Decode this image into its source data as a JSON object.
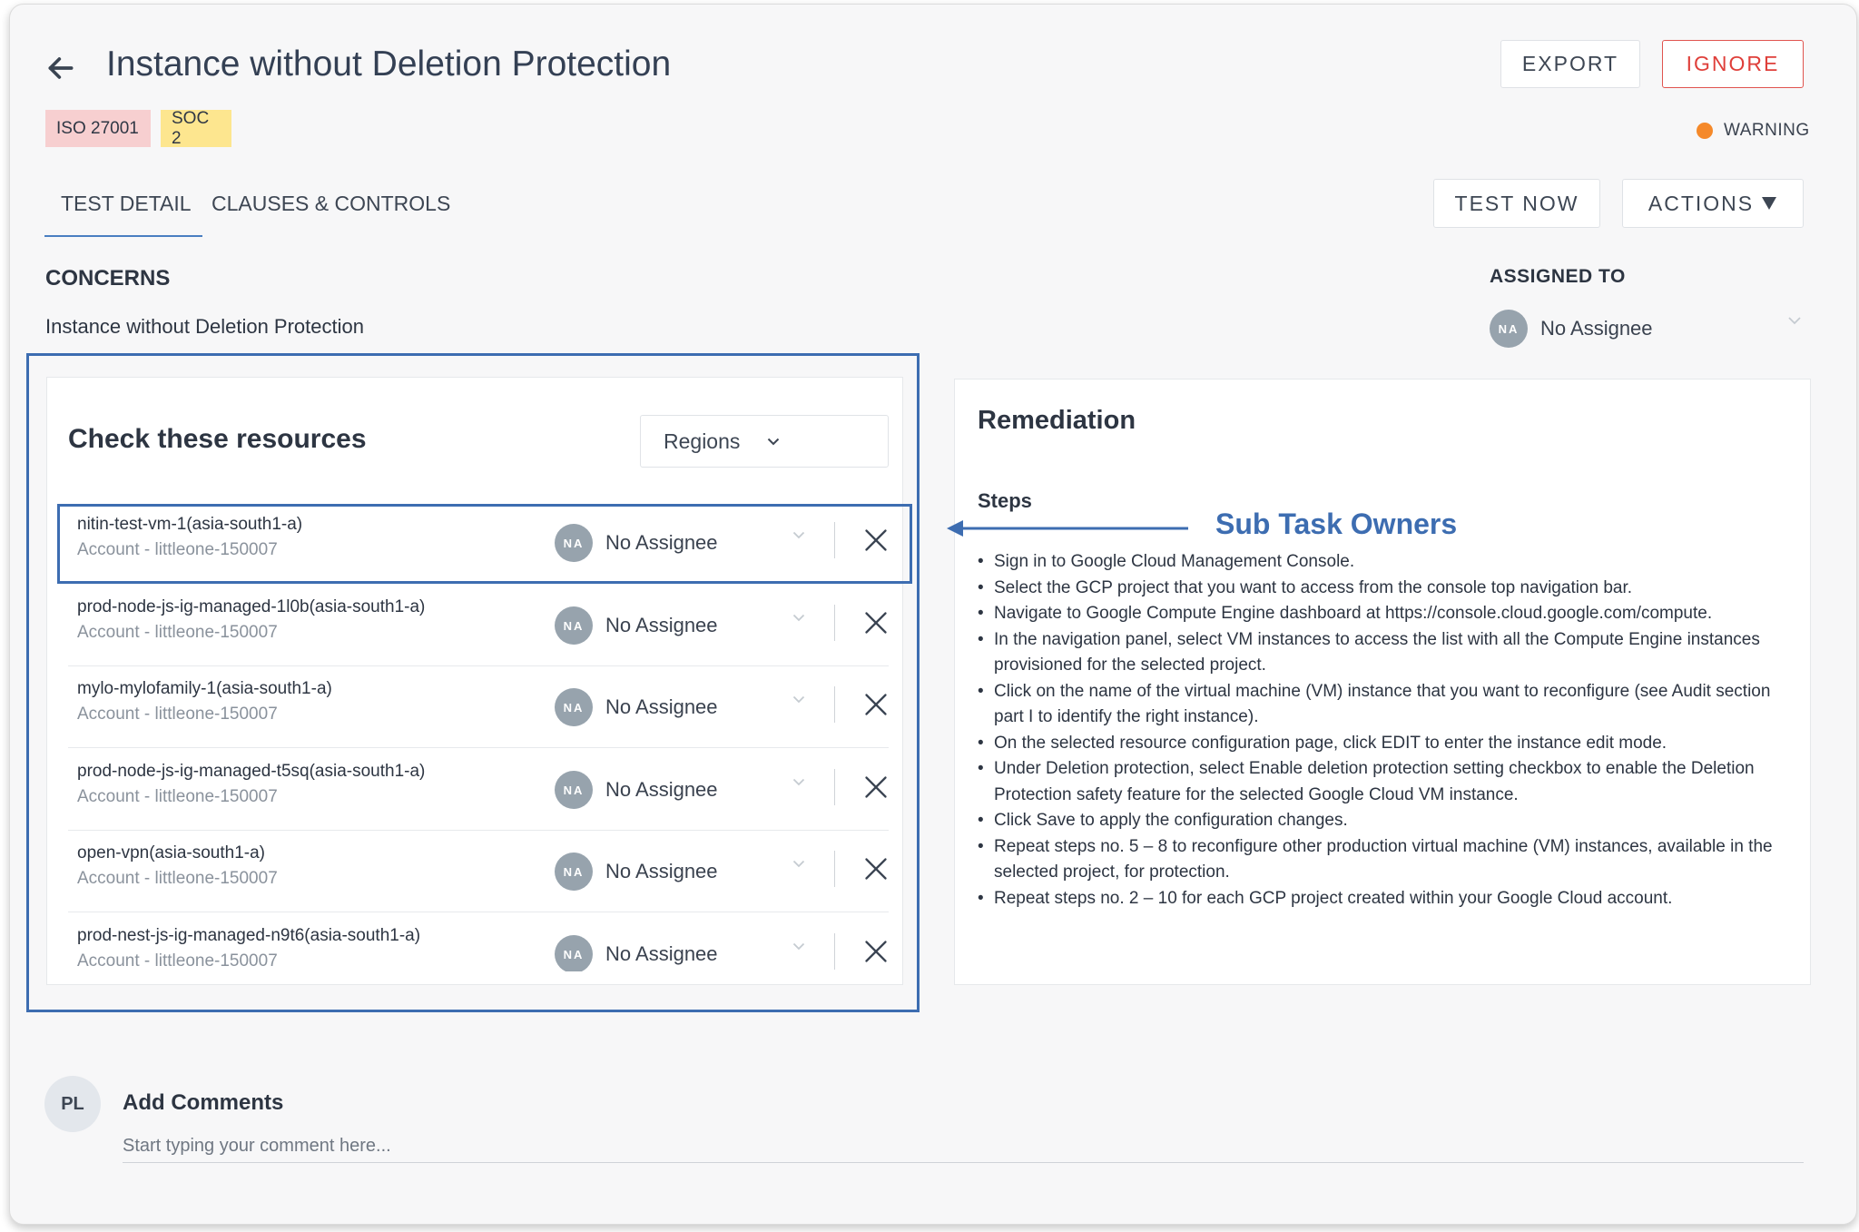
{
  "header": {
    "title": "Instance without Deletion Protection",
    "export_label": "EXPORT",
    "ignore_label": "IGNORE"
  },
  "tags": [
    "ISO 27001",
    "SOC 2"
  ],
  "status": {
    "label": "WARNING",
    "color": "#f5892a"
  },
  "tabs": [
    {
      "label": "TEST DETAIL",
      "active": true
    },
    {
      "label": "CLAUSES & CONTROLS",
      "active": false
    }
  ],
  "toolbar": {
    "test_now_label": "TEST NOW",
    "actions_label": "ACTIONS"
  },
  "concerns": {
    "heading": "CONCERNS",
    "text": "Instance without Deletion Protection"
  },
  "assigned": {
    "heading": "ASSIGNED TO",
    "initials": "NA",
    "name": "No Assignee"
  },
  "resources": {
    "title": "Check these resources",
    "regions_label": "Regions",
    "items": [
      {
        "name": "nitin-test-vm-1(asia-south1-a)",
        "account": "Account - littleone-150007",
        "initials": "NA",
        "assignee": "No Assignee"
      },
      {
        "name": "prod-node-js-ig-managed-1l0b(asia-south1-a)",
        "account": "Account - littleone-150007",
        "initials": "NA",
        "assignee": "No Assignee"
      },
      {
        "name": "mylo-mylofamily-1(asia-south1-a)",
        "account": "Account - littleone-150007",
        "initials": "NA",
        "assignee": "No Assignee"
      },
      {
        "name": "prod-node-js-ig-managed-t5sq(asia-south1-a)",
        "account": "Account - littleone-150007",
        "initials": "NA",
        "assignee": "No Assignee"
      },
      {
        "name": "open-vpn(asia-south1-a)",
        "account": "Account - littleone-150007",
        "initials": "NA",
        "assignee": "No Assignee"
      },
      {
        "name": "prod-nest-js-ig-managed-n9t6(asia-south1-a)",
        "account": "Account - littleone-150007",
        "initials": "NA",
        "assignee": "No Assignee"
      }
    ]
  },
  "remediation": {
    "title": "Remediation",
    "steps_heading": "Steps",
    "steps": [
      "Sign in to Google Cloud Management Console.",
      "Select the GCP project that you want to access from the console top navigation bar.",
      "Navigate to Google Compute Engine dashboard at https://console.cloud.google.com/compute.",
      "In the navigation panel, select VM instances to access the list with all the Compute Engine instances provisioned for the selected project.",
      "Click on the name of the virtual machine (VM) instance that you want to reconfigure (see Audit section part I to identify the right instance).",
      "On the selected resource configuration page, click EDIT to enter the instance edit mode.",
      "Under Deletion protection, select Enable deletion protection setting checkbox to enable the Deletion Protection safety feature for the selected Google Cloud VM instance.",
      "Click Save to apply the configuration changes.",
      "Repeat steps no. 5 – 8 to reconfigure other production virtual machine (VM) instances, available in the selected project, for protection.",
      "Repeat steps no. 2 – 10 for each GCP project created within your Google Cloud account."
    ]
  },
  "annotation": {
    "text": "Sub Task Owners",
    "color": "#3d6db1"
  },
  "comments": {
    "initials": "PL",
    "heading": "Add Comments",
    "placeholder": "Start typing your comment here..."
  },
  "icons": [
    "back-arrow-icon",
    "caret-down-icon",
    "chevron-down-icon",
    "close-icon"
  ]
}
